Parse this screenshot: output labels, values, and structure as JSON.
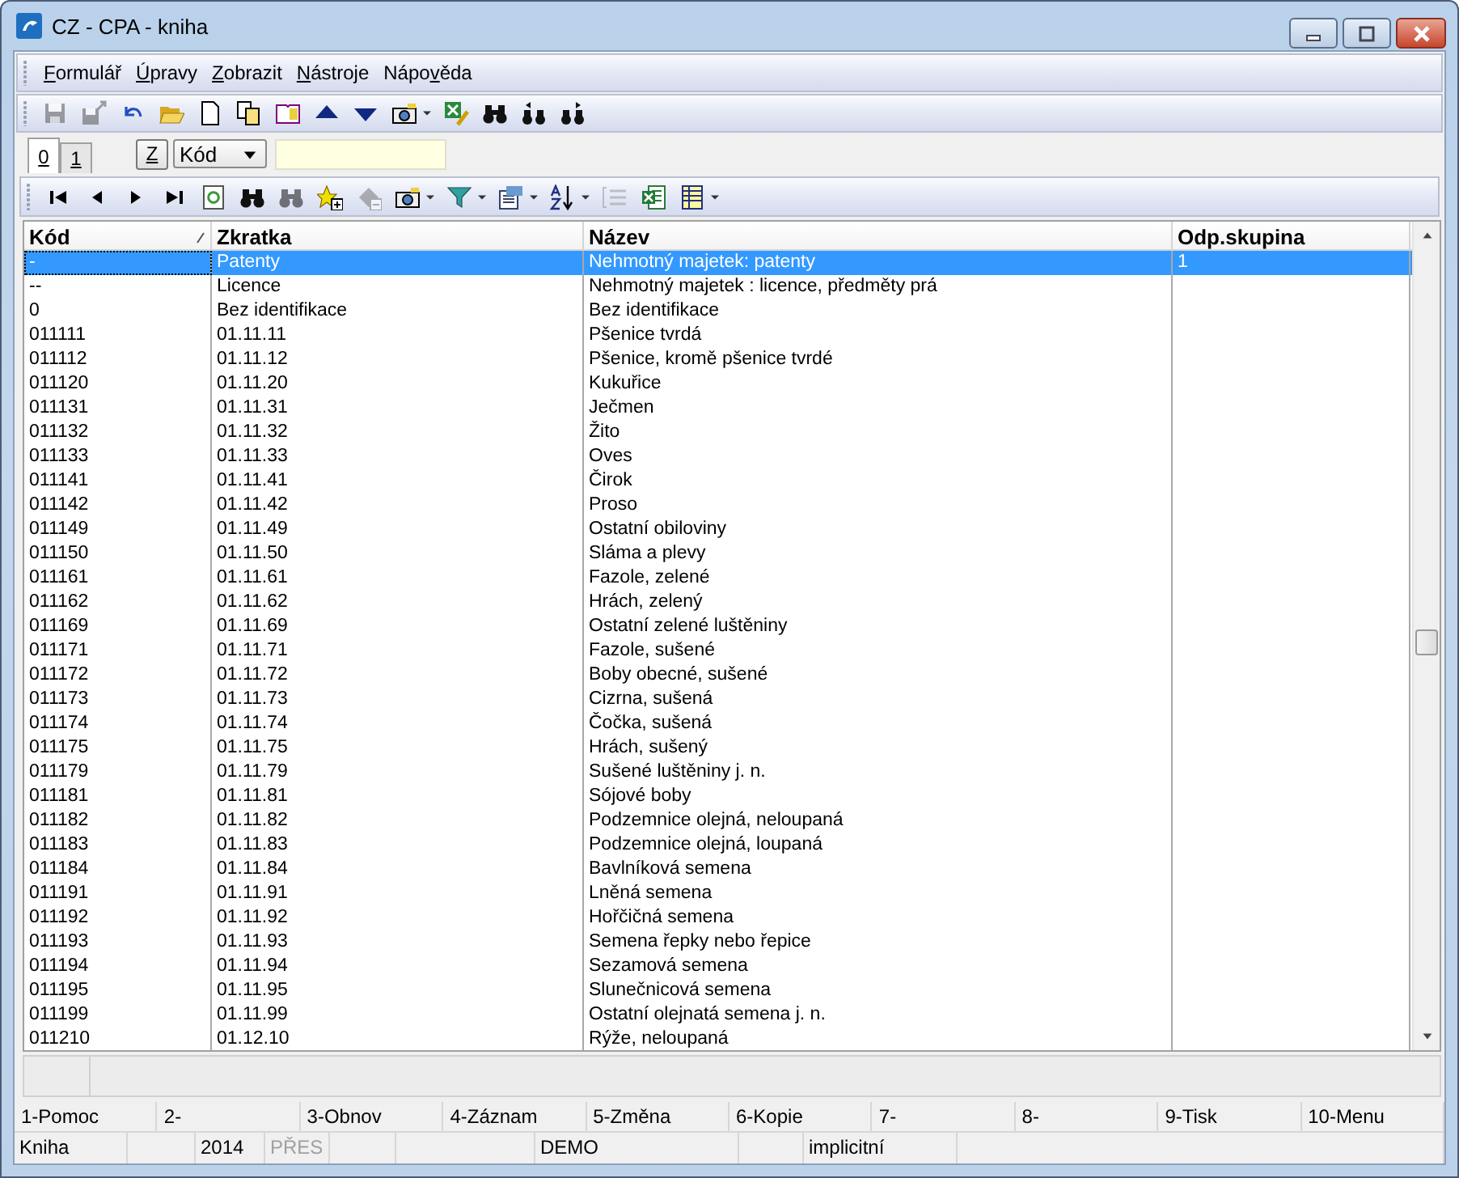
{
  "window": {
    "title": "CZ - CPA - kniha"
  },
  "menu": [
    {
      "key": "F",
      "after": "ormulář"
    },
    {
      "key": "Ú",
      "after": "pravy"
    },
    {
      "key": "Z",
      "after": "obrazit"
    },
    {
      "key": "N",
      "after": "ástroje"
    },
    {
      "before": "Nápo",
      "key": "v",
      "after": "ěda"
    }
  ],
  "toolbar": [
    {
      "kind": "save",
      "disabled": true
    },
    {
      "kind": "saveas",
      "disabled": true
    },
    {
      "kind": "undo",
      "disabled": false
    },
    {
      "kind": "open",
      "disabled": false
    },
    {
      "kind": "new",
      "disabled": false
    },
    {
      "kind": "copy",
      "disabled": false
    },
    {
      "kind": "book",
      "disabled": false
    },
    {
      "kind": "up",
      "disabled": false
    },
    {
      "kind": "down",
      "disabled": false
    },
    {
      "kind": "camera",
      "disabled": false
    },
    {
      "kind": "caret",
      "disabled": false
    },
    {
      "kind": "xedit",
      "disabled": false
    },
    {
      "kind": "find",
      "disabled": false
    },
    {
      "kind": "findprev",
      "disabled": false
    },
    {
      "kind": "findnext",
      "disabled": false
    }
  ],
  "tabs": [
    {
      "label": "0",
      "selected": true
    },
    {
      "label": "1",
      "selected": false
    }
  ],
  "z_button": "Z",
  "sort_field": {
    "value": "Kód"
  },
  "grid_toolbar": [
    {
      "kind": "first",
      "disabled": false
    },
    {
      "kind": "prev",
      "disabled": false
    },
    {
      "kind": "next",
      "disabled": false
    },
    {
      "kind": "last",
      "disabled": false
    },
    {
      "kind": "refresh",
      "disabled": false
    },
    {
      "kind": "find",
      "disabled": false
    },
    {
      "kind": "find",
      "disabled": true
    },
    {
      "kind": "star",
      "disabled": false
    },
    {
      "kind": "del",
      "disabled": true
    },
    {
      "kind": "camera",
      "disabled": false
    },
    {
      "kind": "caret",
      "disabled": false
    },
    {
      "kind": "filter",
      "disabled": false
    },
    {
      "kind": "caret",
      "disabled": false
    },
    {
      "kind": "export",
      "disabled": false
    },
    {
      "kind": "caret",
      "disabled": false
    },
    {
      "kind": "sort",
      "disabled": false
    },
    {
      "kind": "caret",
      "disabled": false
    },
    {
      "kind": "list",
      "disabled": true
    },
    {
      "kind": "excel",
      "disabled": false
    },
    {
      "kind": "table",
      "disabled": false
    },
    {
      "kind": "caret",
      "disabled": false
    }
  ],
  "table": {
    "columns": [
      "Kód",
      "Zkratka",
      "Název",
      "Odp.skupina"
    ],
    "rows": [
      {
        "code": "-",
        "abbr": "Patenty",
        "name": "Nehmotný majetek: patenty",
        "group": "1",
        "selected": true
      },
      {
        "code": "--",
        "abbr": "Licence",
        "name": "Nehmotný majetek : licence, předměty prá",
        "selected": false
      },
      {
        "code": "0",
        "abbr": "Bez identifikace",
        "name": "Bez identifikace",
        "selected": false
      },
      {
        "code": "011111",
        "abbr": "01.11.11",
        "name": "Pšenice tvrdá",
        "selected": false
      },
      {
        "code": "011112",
        "abbr": "01.11.12",
        "name": "Pšenice, kromě pšenice tvrdé",
        "selected": false
      },
      {
        "code": "011120",
        "abbr": "01.11.20",
        "name": "Kukuřice",
        "selected": false
      },
      {
        "code": "011131",
        "abbr": "01.11.31",
        "name": "Ječmen",
        "selected": false
      },
      {
        "code": "011132",
        "abbr": "01.11.32",
        "name": "Žito",
        "selected": false
      },
      {
        "code": "011133",
        "abbr": "01.11.33",
        "name": "Oves",
        "selected": false
      },
      {
        "code": "011141",
        "abbr": "01.11.41",
        "name": "Čirok",
        "selected": false
      },
      {
        "code": "011142",
        "abbr": "01.11.42",
        "name": "Proso",
        "selected": false
      },
      {
        "code": "011149",
        "abbr": "01.11.49",
        "name": "Ostatní obiloviny",
        "selected": false
      },
      {
        "code": "011150",
        "abbr": "01.11.50",
        "name": "Sláma a plevy",
        "selected": false
      },
      {
        "code": "011161",
        "abbr": "01.11.61",
        "name": "Fazole, zelené",
        "selected": false
      },
      {
        "code": "011162",
        "abbr": "01.11.62",
        "name": "Hrách, zelený",
        "selected": false
      },
      {
        "code": "011169",
        "abbr": "01.11.69",
        "name": "Ostatní zelené luštěniny",
        "selected": false
      },
      {
        "code": "011171",
        "abbr": "01.11.71",
        "name": "Fazole, sušené",
        "selected": false
      },
      {
        "code": "011172",
        "abbr": "01.11.72",
        "name": "Boby obecné, sušené",
        "selected": false
      },
      {
        "code": "011173",
        "abbr": "01.11.73",
        "name": "Cizrna, sušená",
        "selected": false
      },
      {
        "code": "011174",
        "abbr": "01.11.74",
        "name": "Čočka, sušená",
        "selected": false
      },
      {
        "code": "011175",
        "abbr": "01.11.75",
        "name": "Hrách, sušený",
        "selected": false
      },
      {
        "code": "011179",
        "abbr": "01.11.79",
        "name": "Sušené luštěniny j. n.",
        "selected": false
      },
      {
        "code": "011181",
        "abbr": "01.11.81",
        "name": "Sójové boby",
        "selected": false
      },
      {
        "code": "011182",
        "abbr": "01.11.82",
        "name": "Podzemnice olejná, neloupaná",
        "selected": false
      },
      {
        "code": "011183",
        "abbr": "01.11.83",
        "name": "Podzemnice olejná, loupaná",
        "selected": false
      },
      {
        "code": "011184",
        "abbr": "01.11.84",
        "name": "Bavlníková semena",
        "selected": false
      },
      {
        "code": "011191",
        "abbr": "01.11.91",
        "name": "Lněná semena",
        "selected": false
      },
      {
        "code": "011192",
        "abbr": "01.11.92",
        "name": "Hořčičná semena",
        "selected": false
      },
      {
        "code": "011193",
        "abbr": "01.11.93",
        "name": "Semena řepky nebo řepice",
        "selected": false
      },
      {
        "code": "011194",
        "abbr": "01.11.94",
        "name": "Sezamová semena",
        "selected": false
      },
      {
        "code": "011195",
        "abbr": "01.11.95",
        "name": "Slunečnicová semena",
        "selected": false
      },
      {
        "code": "011199",
        "abbr": "01.11.99",
        "name": "Ostatní olejnatá semena j. n.",
        "selected": false
      },
      {
        "code": "011210",
        "abbr": "01.12.10",
        "name": "Rýže, neloupaná",
        "selected": false
      }
    ]
  },
  "function_keys": [
    "1-Pomoc",
    "2-",
    "3-Obnov",
    "4-Záznam",
    "5-Změna",
    "6-Kopie",
    "7-",
    "8-",
    "9-Tisk",
    "10-Menu"
  ],
  "status_bar": [
    {
      "text": "Kniha",
      "disabled": false
    },
    {
      "text": "2014",
      "disabled": false
    },
    {
      "text": "PŘES",
      "disabled": true
    },
    {
      "text": "DEMO",
      "disabled": false
    },
    {
      "text": "implicitní",
      "disabled": false
    }
  ]
}
